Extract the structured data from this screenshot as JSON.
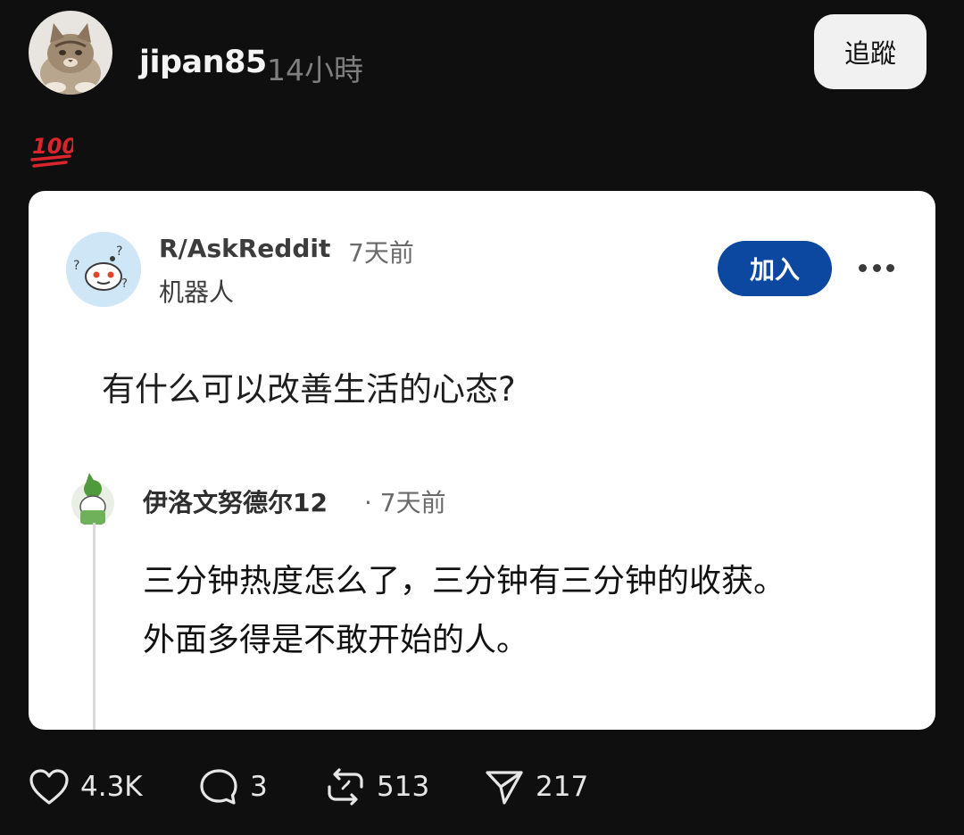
{
  "post": {
    "username": "jipan85",
    "time": "14小時",
    "follow_label": "追蹤",
    "emoji": "💯"
  },
  "card": {
    "subreddit": "R/AskReddit",
    "sub_time": "7天前",
    "tag": "机器人",
    "join_label": "加入",
    "question": "有什么可以改善生活的心态?",
    "comment": {
      "author": "伊洛文努德尔12",
      "time": "· 7天前",
      "line1": "三分钟热度怎么了，三分钟有三分钟的收获。",
      "line2": "外面多得是不敢开始的人。"
    }
  },
  "actions": {
    "likes": "4.3K",
    "comments": "3",
    "reposts": "513",
    "shares": "217"
  },
  "colors": {
    "background": "#0f0f10",
    "join_button": "#0d48a0",
    "emoji_red": "#d8262c"
  },
  "icons": [
    "cat-avatar",
    "hundred-points-emoji",
    "reddit-avatar-icon",
    "more-icon",
    "commenter-avatar",
    "heart-icon",
    "comment-icon",
    "repost-icon",
    "send-icon"
  ]
}
